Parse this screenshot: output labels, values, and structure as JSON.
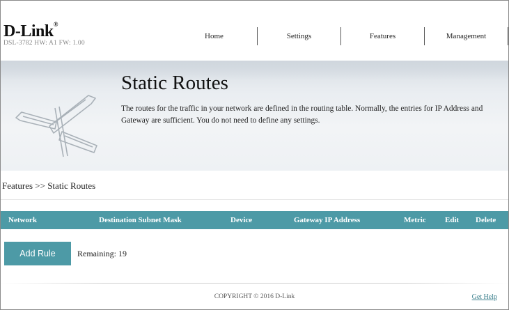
{
  "brand": {
    "logo_text": "D-Link",
    "logo_mark": "®",
    "hardware_info": "DSL-3782  HW: A1  FW: 1.00"
  },
  "nav": {
    "home": "Home",
    "settings": "Settings",
    "features": "Features",
    "management": "Management"
  },
  "banner": {
    "icon": "signpost-icon",
    "title": "Static Routes",
    "description": "The routes for the traffic in your network are defined in the routing table. Normally, the entries for IP Address and Gateway are sufficient. You do not need to define any settings."
  },
  "breadcrumb": "Features >> Static Routes",
  "table": {
    "columns": [
      "Network",
      "Destination Subnet Mask",
      "Device",
      "Gateway IP Address",
      "Metric",
      "Edit",
      "Delete"
    ],
    "rows": []
  },
  "rules": {
    "add_label": "Add Rule",
    "remaining_label": "Remaining:",
    "remaining_count": "19"
  },
  "footer": {
    "copyright": "COPYRIGHT © 2016 D-Link",
    "help": "Get Help"
  },
  "colors": {
    "accent": "#4d9aa6",
    "banner_bg": "#eef1f4",
    "text": "#222222"
  }
}
